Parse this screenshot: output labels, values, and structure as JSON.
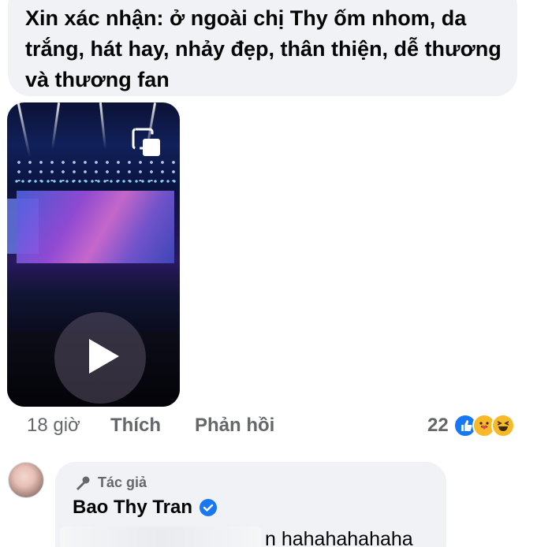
{
  "comment": {
    "text": "Xin xác nhận: ở ngoài chị Thy ốm nhom, da trắng, hát hay, nhảy đẹp, thân thiện, dễ thương và thương fan",
    "time": "18 giờ",
    "like_label": "Thích",
    "reply_label": "Phản hồi",
    "reaction_count": "22",
    "reactions": [
      "like-icon",
      "care-icon",
      "haha-icon"
    ]
  },
  "video": {
    "play_icon": "play-icon",
    "pip_icon": "picture-in-picture-icon"
  },
  "reply": {
    "author_badge": "Tác giả",
    "author_name": "Bao Thy Tran",
    "text": "n hahahahahaha"
  },
  "colors": {
    "bubble": "#f0f2f5",
    "secondary_text": "#65676b",
    "like_blue": "#1877f2",
    "emoji_yellow": "#f7b928"
  }
}
